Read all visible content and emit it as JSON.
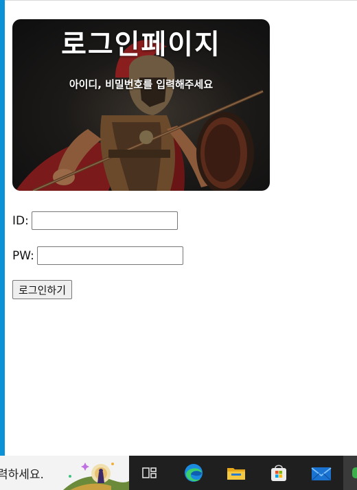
{
  "hero": {
    "title": "로그인페이지",
    "subtitle": "아이디, 비밀번호를 입력해주세요"
  },
  "form": {
    "id_label": "ID:",
    "id_value": "",
    "pw_label": "PW:",
    "pw_value": "",
    "submit_label": "로그인하기"
  },
  "taskbar": {
    "search_text": "력하세요.",
    "icons": [
      "task-view-icon",
      "edge-icon",
      "file-explorer-icon",
      "microsoft-store-icon",
      "mail-icon"
    ]
  },
  "colors": {
    "window_edge": "#0a91d6",
    "taskbar": "#1f1f1f"
  }
}
